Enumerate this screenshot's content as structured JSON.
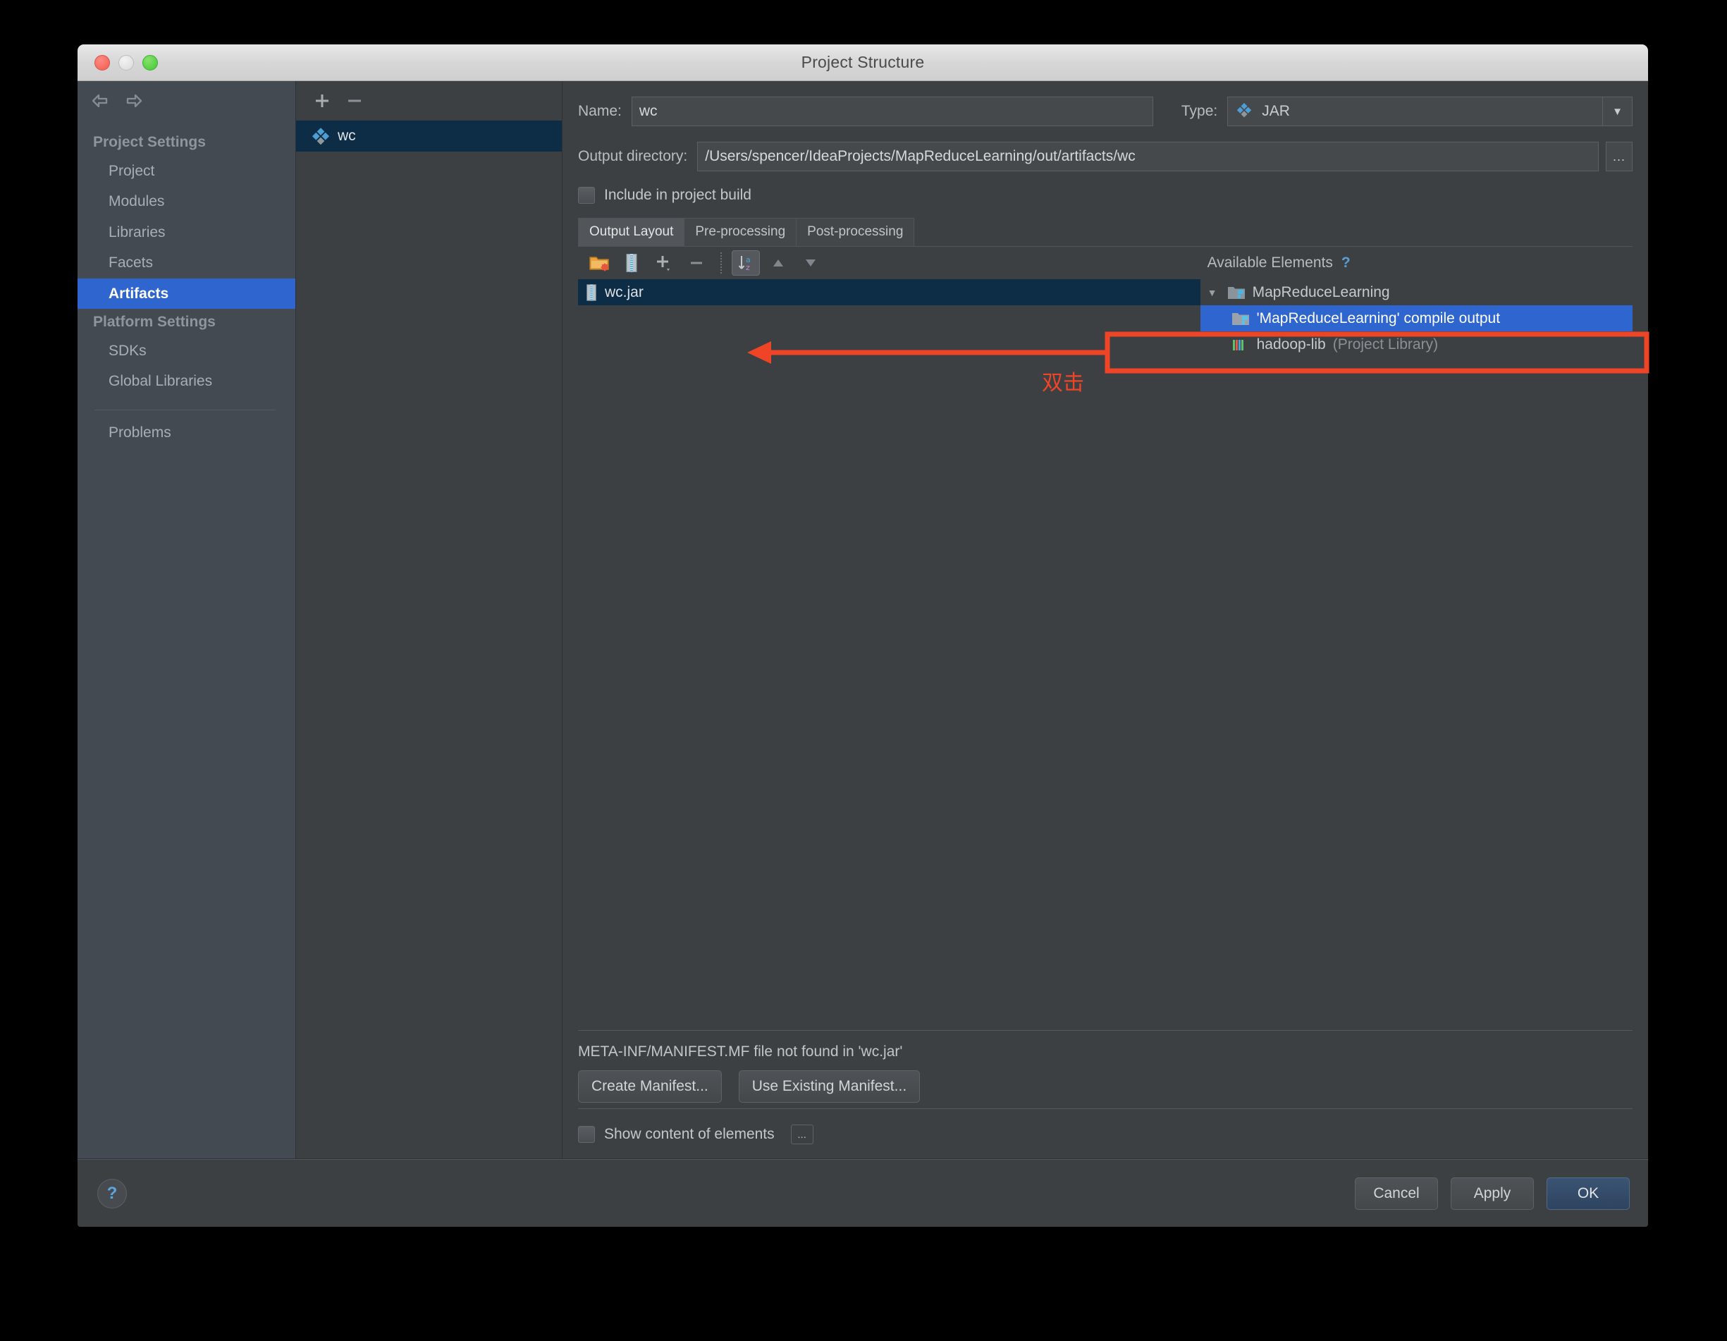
{
  "window": {
    "title": "Project Structure",
    "traffic_lights": [
      "close-button",
      "minimize-button",
      "zoom-button"
    ]
  },
  "sidebar": {
    "back_icon": "arrow-left-icon",
    "forward_icon": "arrow-right-icon",
    "groups": [
      {
        "label": "Project Settings",
        "items": [
          {
            "label": "Project",
            "selected": false
          },
          {
            "label": "Modules",
            "selected": false
          },
          {
            "label": "Libraries",
            "selected": false
          },
          {
            "label": "Facets",
            "selected": false
          },
          {
            "label": "Artifacts",
            "selected": true
          }
        ]
      },
      {
        "label": "Platform Settings",
        "items": [
          {
            "label": "SDKs",
            "selected": false
          },
          {
            "label": "Global Libraries",
            "selected": false
          }
        ]
      }
    ],
    "extra": [
      {
        "label": "Problems",
        "selected": false
      }
    ]
  },
  "artifacts_panel": {
    "toolbar": [
      {
        "name": "add-artifact-button",
        "glyph": "+"
      },
      {
        "name": "remove-artifact-button",
        "glyph": "−"
      }
    ],
    "items": [
      {
        "label": "wc",
        "icon": "artifact-diamond-icon",
        "selected": true
      }
    ]
  },
  "detail": {
    "name_label": "Name:",
    "name_value": "wc",
    "type_label": "Type:",
    "type_value": "JAR",
    "output_dir_label": "Output directory:",
    "output_dir_value": "/Users/spencer/IdeaProjects/MapReduceLearning/out/artifacts/wc",
    "browse_label": "...",
    "include_in_build_label": "Include in project build",
    "include_in_build_checked": false,
    "tabs": [
      {
        "label": "Output Layout",
        "active": true
      },
      {
        "label": "Pre-processing",
        "active": false
      },
      {
        "label": "Post-processing",
        "active": false
      }
    ],
    "layout_toolbar": [
      {
        "name": "create-directory-button",
        "icon": "folder-add-icon"
      },
      {
        "name": "create-archive-button",
        "icon": "jar-icon"
      },
      {
        "name": "add-copy-of-button",
        "icon": "plus-dropdown-icon"
      },
      {
        "name": "remove-element-button",
        "icon": "minus-icon"
      },
      {
        "name": "sort-button",
        "icon": "sort-az-icon",
        "pressed": true
      },
      {
        "name": "move-up-button",
        "icon": "triangle-up-icon"
      },
      {
        "name": "move-down-button",
        "icon": "triangle-down-icon"
      }
    ],
    "output_tree": [
      {
        "label": "wc.jar",
        "icon": "jar-icon",
        "selected": true,
        "indent": 0
      }
    ],
    "available_elements_title": "Available Elements",
    "available_help_glyph": "?",
    "available_tree": [
      {
        "label": "MapReduceLearning",
        "icon": "module-folder-icon",
        "indent": 0,
        "expander": "▼",
        "state": "normal"
      },
      {
        "label": "'MapReduceLearning' compile output",
        "icon": "module-folder-icon",
        "indent": 1,
        "expander": "",
        "state": "selected"
      },
      {
        "label": "hadoop-lib",
        "suffix": " (Project Library)",
        "icon": "library-icon",
        "indent": 1,
        "expander": "",
        "state": "normal"
      }
    ],
    "manifest_message": "META-INF/MANIFEST.MF file not found in 'wc.jar'",
    "manifest_buttons": [
      {
        "label": "Create Manifest..."
      },
      {
        "label": "Use Existing Manifest..."
      }
    ],
    "show_content_label": "Show content of elements",
    "show_content_checked": false,
    "show_content_more": "..."
  },
  "bottom_bar": {
    "help_glyph": "?",
    "buttons": [
      {
        "label": "Cancel",
        "primary": false
      },
      {
        "label": "Apply",
        "primary": false
      },
      {
        "label": "OK",
        "primary": true
      }
    ]
  },
  "annotations": {
    "double_click_text": "双击",
    "color": "#ef4526"
  }
}
